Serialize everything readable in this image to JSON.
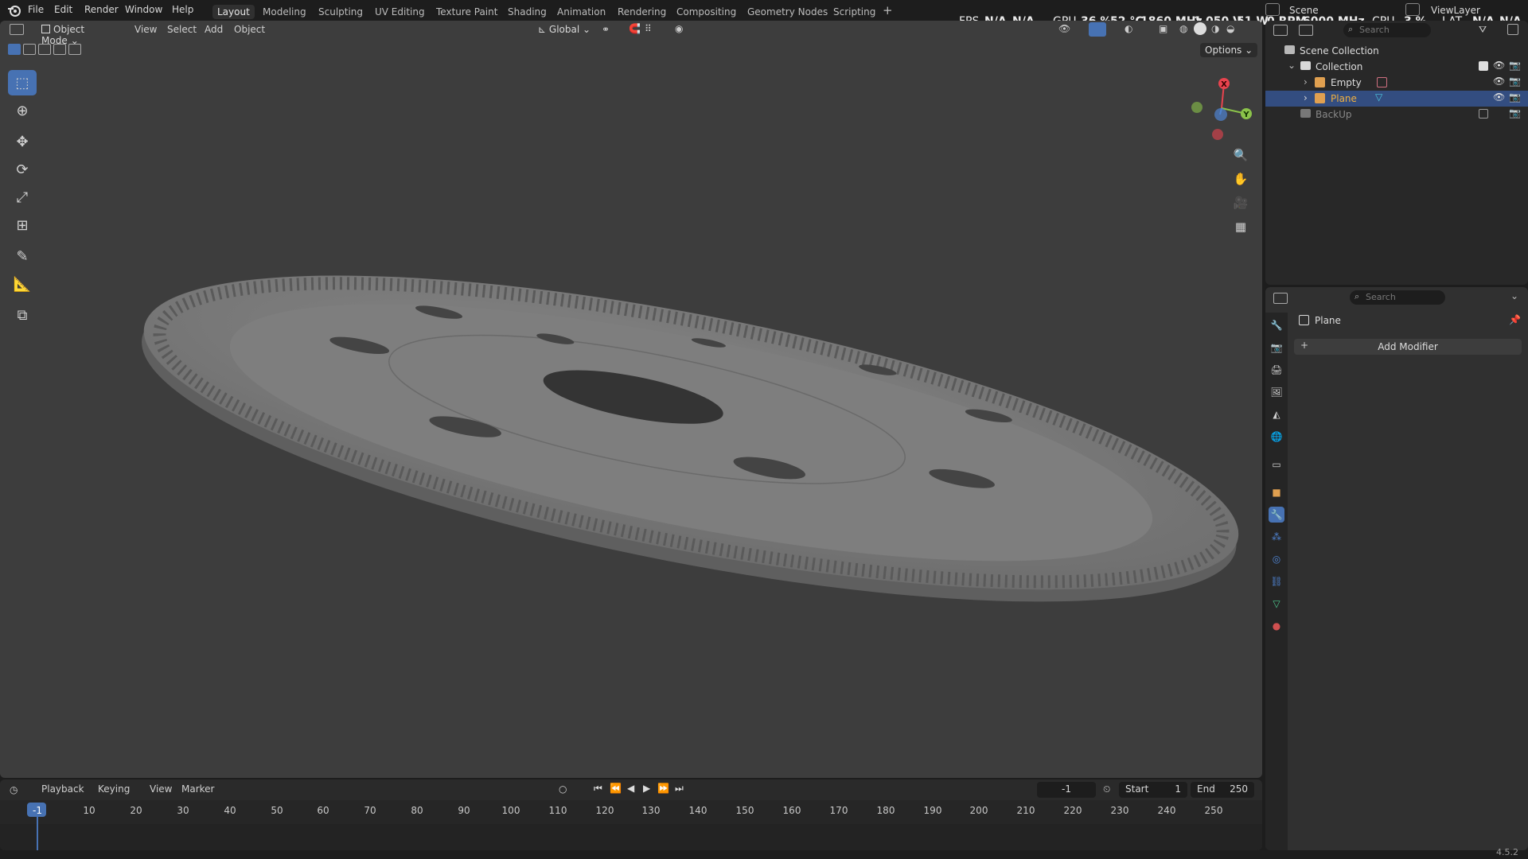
{
  "menus": [
    "File",
    "Edit",
    "Render",
    "Window",
    "Help"
  ],
  "workspaces": [
    {
      "label": "Layout",
      "active": true
    },
    {
      "label": "Modeling",
      "active": false
    },
    {
      "label": "Sculpting",
      "active": false
    },
    {
      "label": "UV Editing",
      "active": false
    },
    {
      "label": "Texture Paint",
      "active": false
    },
    {
      "label": "Shading",
      "active": false
    },
    {
      "label": "Animation",
      "active": false
    },
    {
      "label": "Rendering",
      "active": false
    },
    {
      "label": "Compositing",
      "active": false
    },
    {
      "label": "Geometry Nodes",
      "active": false
    },
    {
      "label": "Scripting",
      "active": false
    }
  ],
  "stats": {
    "fps_label": "FPS",
    "fps_value": "N/A",
    "fps_value2": "N/A",
    "gpu_label": "GPU",
    "gpu_util": "36 %",
    "gpu_temp": "52 °C",
    "gpu_clock": "1860 MHz",
    "gpu_volt": "1.050 V",
    "gpu_power": "51 W",
    "gpu_rpm": "0 RPM",
    "gpu_mem": "6000 MHz",
    "cpu_label": "CPU",
    "cpu_value": "3 %",
    "lat_label": "LAT",
    "lat_value": "N/A",
    "lat_value2": "N/A"
  },
  "scene": {
    "name": "Scene",
    "view_layer": "ViewLayer"
  },
  "viewport": {
    "mode": "Object Mode",
    "menus": [
      "View",
      "Select",
      "Add",
      "Object"
    ],
    "orientation": "Global",
    "options_label": "Options",
    "gizmo": {
      "x": "X",
      "y": "Y"
    }
  },
  "outliner": {
    "search_placeholder": "Search",
    "scene_collection": "Scene Collection",
    "collection": "Collection",
    "items": [
      "Empty",
      "Plane"
    ],
    "backup": "BackUp"
  },
  "properties": {
    "search_placeholder": "Search",
    "object_name": "Plane",
    "add_modifier": "Add Modifier"
  },
  "timeline": {
    "menus": [
      "Playback",
      "Keying",
      "View",
      "Marker"
    ],
    "current_frame": "-1",
    "start_label": "Start",
    "start_value": "1",
    "end_label": "End",
    "end_value": "250",
    "ticks": [
      "-1",
      "10",
      "20",
      "30",
      "40",
      "50",
      "60",
      "70",
      "80",
      "90",
      "100",
      "110",
      "120",
      "130",
      "140",
      "150",
      "160",
      "170",
      "180",
      "190",
      "200",
      "210",
      "220",
      "230",
      "240",
      "250"
    ]
  },
  "version": "4.5.2",
  "colors": {
    "accent": "#4772b3",
    "selection": "#334d80",
    "x_axis": "#e8434e",
    "y_axis": "#8bc34a",
    "z_axis": "#4f83d1"
  }
}
